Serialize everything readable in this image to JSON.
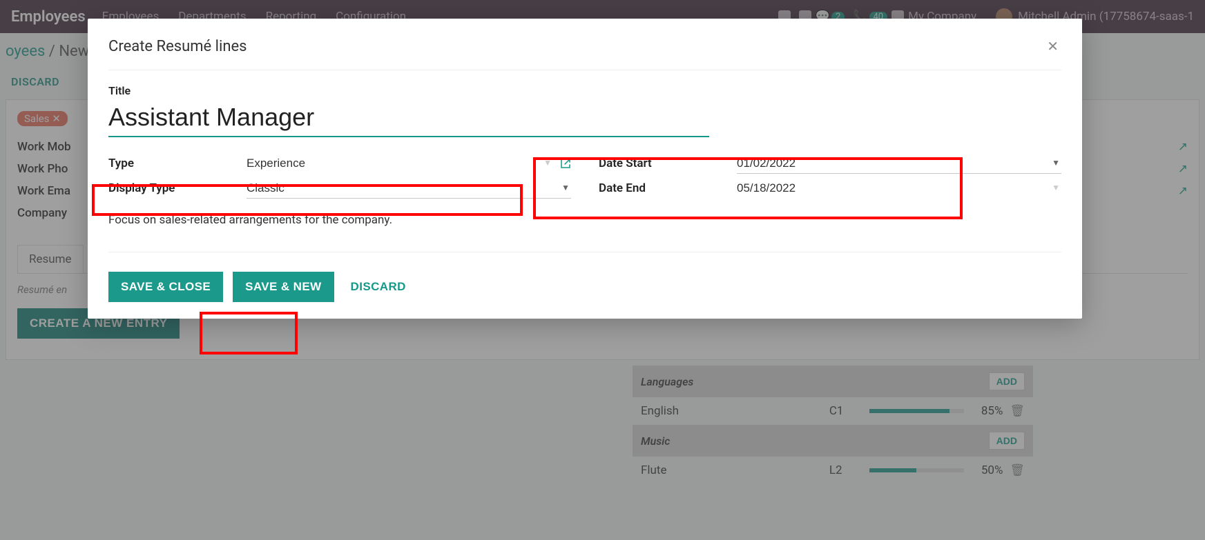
{
  "topbar": {
    "brand": "Employees",
    "menus": [
      "Employees",
      "Departments",
      "Reporting",
      "Configuration"
    ],
    "badge1": "2",
    "badge2": "40",
    "company": "My Company",
    "user": "Mitchell Admin (17758674-saas-1"
  },
  "breadcrumb": {
    "c1": "oyees",
    "sep": " / ",
    "c2": "New"
  },
  "discard": "DISCARD",
  "form": {
    "tag": "Sales",
    "rows": [
      "Work Mob",
      "Work Pho",
      "Work Ema",
      "Company"
    ],
    "tab": "Resume",
    "resume_label": "Resumé en",
    "new_entry": "CREATE A NEW ENTRY"
  },
  "skills": {
    "groups": [
      {
        "title": "Languages",
        "add": "ADD",
        "items": [
          {
            "name": "English",
            "level": "C1",
            "pct": "85%",
            "fill": 85
          }
        ]
      },
      {
        "title": "Music",
        "add": "ADD",
        "items": [
          {
            "name": "Flute",
            "level": "L2",
            "pct": "50%",
            "fill": 50
          }
        ]
      }
    ]
  },
  "modal": {
    "title": "Create Resumé lines",
    "fields": {
      "title_label": "Title",
      "title_value": "Assistant Manager",
      "type_label": "Type",
      "type_value": "Experience",
      "display_type_label": "Display Type",
      "display_type_value": "Classic",
      "date_start_label": "Date Start",
      "date_start_value": "01/02/2022",
      "date_end_label": "Date End",
      "date_end_value": "05/18/2022",
      "description": "Focus on sales-related arrangements for the company."
    },
    "buttons": {
      "save_close": "SAVE & CLOSE",
      "save_new": "SAVE & NEW",
      "discard": "DISCARD"
    }
  }
}
